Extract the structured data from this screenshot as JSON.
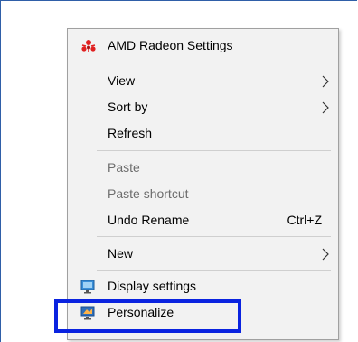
{
  "context_menu": {
    "radeon": {
      "label": "AMD Radeon Settings",
      "icon": "amd-radeon-icon"
    },
    "view": {
      "label": "View",
      "submenu": true
    },
    "sort_by": {
      "label": "Sort by",
      "submenu": true
    },
    "refresh": {
      "label": "Refresh"
    },
    "paste": {
      "label": "Paste",
      "disabled": true
    },
    "paste_shortcut": {
      "label": "Paste shortcut",
      "disabled": true
    },
    "undo_rename": {
      "label": "Undo Rename",
      "shortcut": "Ctrl+Z"
    },
    "new": {
      "label": "New",
      "submenu": true
    },
    "display_settings": {
      "label": "Display settings",
      "icon": "display-settings-icon"
    },
    "personalize": {
      "label": "Personalize",
      "icon": "personalize-icon"
    }
  },
  "colors": {
    "menu_background": "#f2f2f2",
    "highlight_border": "#0a23e0",
    "disabled_text": "#6d6d6d",
    "frame_border": "#2f5fa8"
  }
}
